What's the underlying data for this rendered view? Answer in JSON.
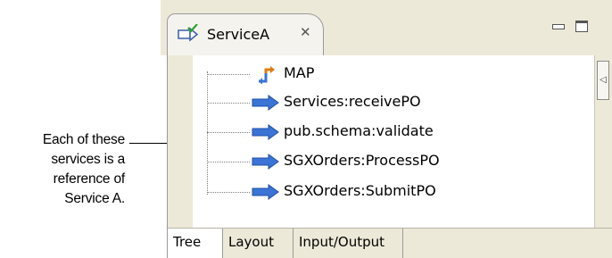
{
  "callout": {
    "lines": [
      "Each of these",
      "services is a",
      "reference of",
      "Service A."
    ]
  },
  "editor": {
    "tab_title": "ServiceA",
    "tab_icon": "service-edit-icon",
    "close_icon": "close-x-icon"
  },
  "tree": {
    "items": [
      {
        "label": "MAP",
        "icon": "map-step-icon"
      },
      {
        "label": "Services:receivePO",
        "icon": "invoke-arrow-icon"
      },
      {
        "label": "pub.schema:validate",
        "icon": "invoke-arrow-icon"
      },
      {
        "label": "SGXOrders:ProcessPO",
        "icon": "invoke-arrow-icon"
      },
      {
        "label": "SGXOrders:SubmitPO",
        "icon": "invoke-arrow-icon"
      }
    ]
  },
  "bottom_tabs": [
    {
      "label": "Tree",
      "active": true
    },
    {
      "label": "Layout",
      "active": false
    },
    {
      "label": "Input/Output",
      "active": false
    }
  ],
  "colors": {
    "chrome": "#ece9d8",
    "arrow_blue": "#3b74d4",
    "map_orange": "#e07b12"
  }
}
